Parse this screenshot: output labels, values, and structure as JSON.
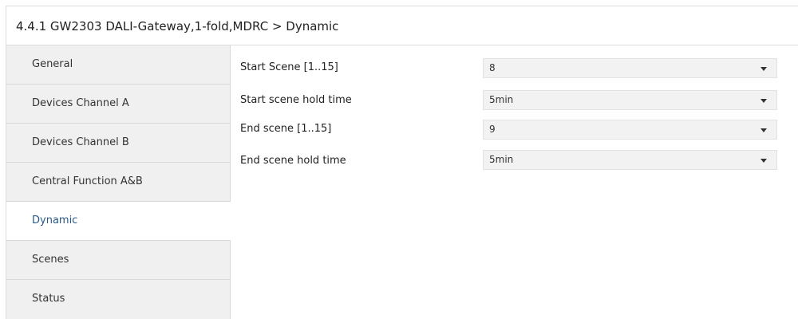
{
  "window": {
    "title": "4.4.1 GW2303 DALI-Gateway,1-fold,MDRC > Dynamic"
  },
  "sidebar": {
    "active_index": 4,
    "items": [
      {
        "label": "General"
      },
      {
        "label": "Devices Channel A"
      },
      {
        "label": "Devices Channel B"
      },
      {
        "label": "Central Function A&B"
      },
      {
        "label": "Dynamic"
      },
      {
        "label": "Scenes"
      },
      {
        "label": "Status"
      }
    ]
  },
  "parameters": [
    {
      "label": "Start Scene [1..15]",
      "value": "8"
    },
    {
      "label": "Start scene hold time",
      "value": "5min"
    },
    {
      "label": "End scene [1..15]",
      "value": "9"
    },
    {
      "label": "End scene hold time",
      "value": "5min"
    }
  ],
  "colors": {
    "active_item_text": "#2a5a8a",
    "sidebar_bg": "#f0f0f0",
    "combo_bg": "#f2f2f2"
  },
  "icons": {
    "dropdown": "chevron-down-icon"
  }
}
